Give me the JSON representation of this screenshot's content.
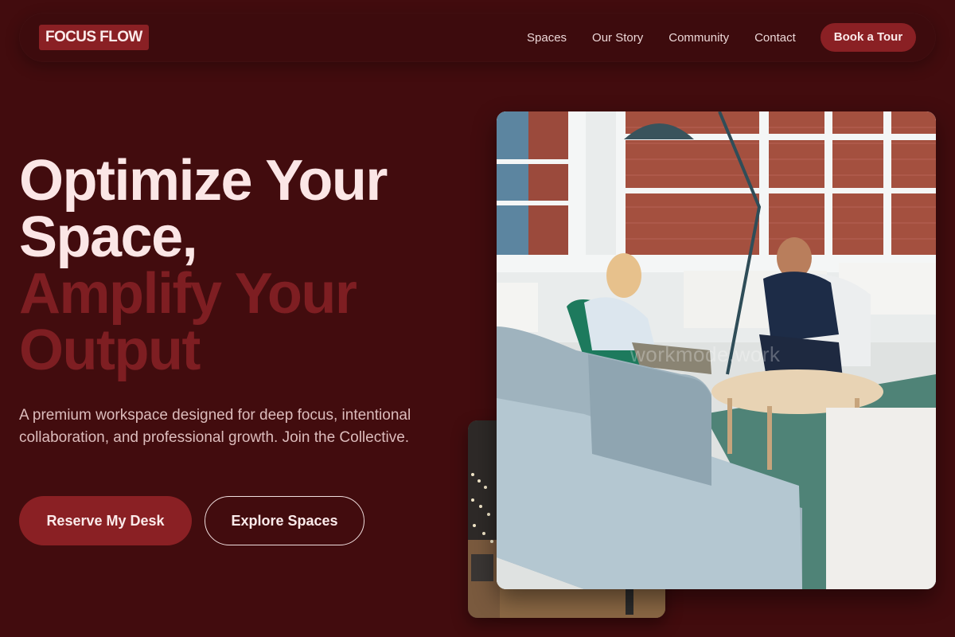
{
  "brand": {
    "name": "FOCUS FLOW"
  },
  "nav": {
    "links": [
      "Spaces",
      "Our Story",
      "Community",
      "Contact"
    ],
    "cta": "Book a Tour"
  },
  "hero": {
    "title_line1": "Optimize Your Space,",
    "title_line2": "Amplify Your Output",
    "description": "A premium workspace designed for deep focus, intentional collaboration, and professional growth. Join the Collective.",
    "primary_button": "Reserve My Desk",
    "secondary_button": "Explore Spaces"
  },
  "images": {
    "main_watermark": "workmode.work"
  },
  "colors": {
    "background": "#420c0e",
    "accent": "#8a2024",
    "headline_light": "#fbe6e6",
    "headline_dark": "#7e1e22"
  }
}
